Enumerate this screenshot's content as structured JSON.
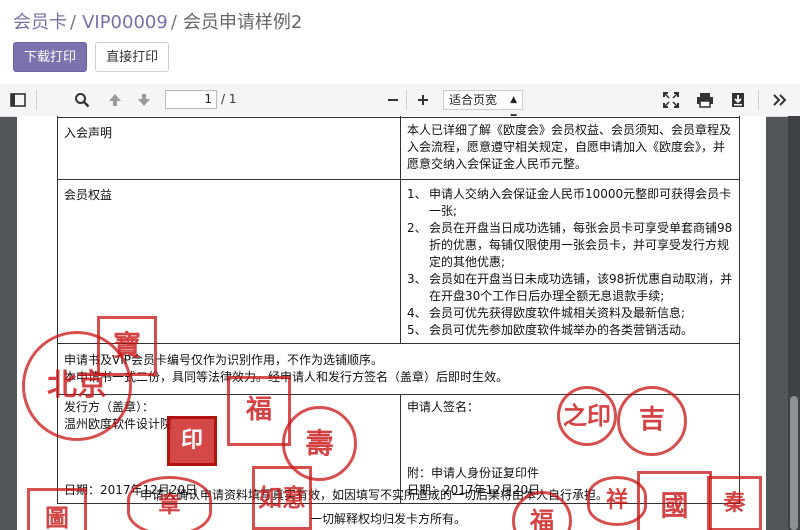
{
  "breadcrumb": {
    "item1": "会员卡",
    "item2": "VIP00009",
    "current": "会员申请样例2",
    "sep": "/"
  },
  "actions": {
    "download_label": "下载打印",
    "direct_label": "直接打印"
  },
  "viewer_toolbar": {
    "page_current": "1",
    "page_total": "/ 1",
    "zoom_label": "适合页宽"
  },
  "document": {
    "top_row_left": "",
    "top_row_right": "",
    "declaration_label": "入会声明",
    "declaration_text": "本人已详细了解《欧度会》会员权益、会员须知、会员章程及入会流程，愿意遵守相关规定，自愿申请加入《欧度会》，并愿意交纳入会保证金人民币元整。",
    "benefits_label": "会员权益",
    "benefits": [
      {
        "num": "1、",
        "text": "申请人交纳入会保证金人民币10000元整即可获得会员卡一张;"
      },
      {
        "num": "2、",
        "text": "会员在开盘当日成功选铺，每张会员卡可享受单套商铺98折的优惠，每铺仅限使用一张会员卡，并可享受发行方规定的其他优惠;"
      },
      {
        "num": "3、",
        "text": "会员如在开盘当日未成功选铺，该98折优惠自动取消，并在开盘30个工作日后办理全额无息退款手续;"
      },
      {
        "num": "4、",
        "text": "会员可优先获得欧度软件城相关资料及最新信息;"
      },
      {
        "num": "5、",
        "text": "会员可优先参加欧度软件城举办的各类营销活动。"
      }
    ],
    "note1": "申请书及VIP会员卡编号仅作为识别作用，不作为选铺顺序。",
    "note2": "本申请书一式二份，具同等法律效力。经申请人和发行方签名（盖章）后即时生效。",
    "issuer_label": "发行方（盖章）：",
    "issuer_name": "温州欧度软件设计院",
    "applicant_label": "申请人签名：",
    "attachment": "附：申请人身份证复印件",
    "date_left": "日期：2017年12月20日",
    "date_right": "日期：2017年12月20日",
    "footer1": "申请人确认申请资料填写真实有效，如因填写不实所造成的一切后果将由本人自行承担。",
    "footer2": "一切解释权均归发卡方所有。"
  },
  "stamps": [
    "北京",
    "寶",
    "福",
    "壽",
    "印",
    "圖",
    "章",
    "如意",
    "之印",
    "吉",
    "祥",
    "國",
    "福",
    "秦"
  ],
  "colors": {
    "accent": "#7c72ad",
    "stamp_red": "#c81414",
    "viewer_bg": "#525659"
  }
}
